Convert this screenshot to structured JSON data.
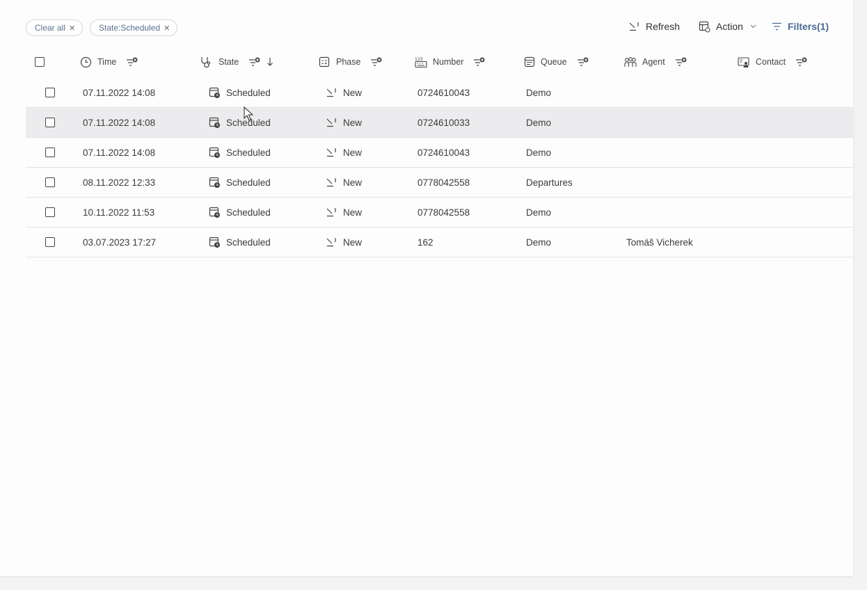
{
  "filters": {
    "clear_all_label": "Clear all",
    "chip_label": "State:Scheduled"
  },
  "toolbar": {
    "refresh_label": "Refresh",
    "action_label": "Action",
    "filters_label": "Filters(1)"
  },
  "columns": {
    "time": "Time",
    "state": "State",
    "phase": "Phase",
    "number": "Number",
    "queue": "Queue",
    "agent": "Agent",
    "contact": "Contact"
  },
  "rows": [
    {
      "time": "07.11.2022 14:08",
      "state": "Scheduled",
      "phase": "New",
      "number": "0724610043",
      "queue": "Demo",
      "agent": "",
      "contact": ""
    },
    {
      "time": "07.11.2022 14:08",
      "state": "Scheduled",
      "phase": "New",
      "number": "0724610033",
      "queue": "Demo",
      "agent": "",
      "contact": ""
    },
    {
      "time": "07.11.2022 14:08",
      "state": "Scheduled",
      "phase": "New",
      "number": "0724610043",
      "queue": "Demo",
      "agent": "",
      "contact": ""
    },
    {
      "time": "08.11.2022 12:33",
      "state": "Scheduled",
      "phase": "New",
      "number": "0778042558",
      "queue": "Departures",
      "agent": "",
      "contact": ""
    },
    {
      "time": "10.11.2022 11:53",
      "state": "Scheduled",
      "phase": "New",
      "number": "0778042558",
      "queue": "Demo",
      "agent": "",
      "contact": ""
    },
    {
      "time": "03.07.2023 17:27",
      "state": "Scheduled",
      "phase": "New",
      "number": "162",
      "queue": "Demo",
      "agent": "Tomáš Vicherek",
      "contact": ""
    }
  ],
  "icons": {
    "time": "clock-icon",
    "state": "stethoscope-icon",
    "phase": "phase-icon",
    "number": "number-icon",
    "queue": "queue-icon",
    "agent": "agent-icon",
    "contact": "contact-icon",
    "column_filter": "filter-add-icon",
    "sort": "sort-descending-icon",
    "row_state": "scheduled-icon",
    "row_phase": "phase-new-icon"
  }
}
